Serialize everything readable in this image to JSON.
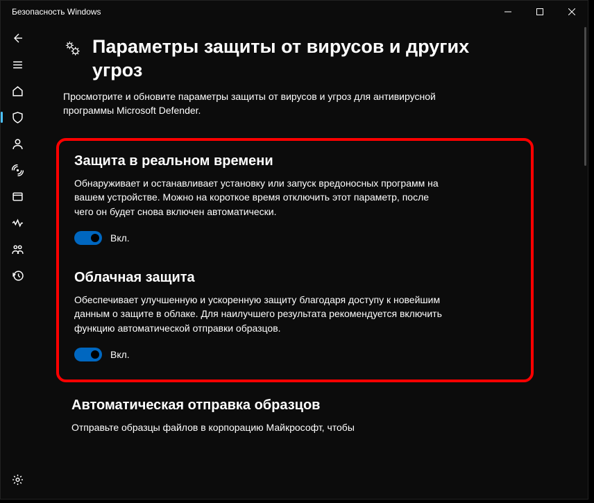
{
  "window": {
    "title": "Безопасность Windows"
  },
  "page": {
    "heading": "Параметры защиты от вирусов и других угроз",
    "subtitle": "Просмотрите и обновите параметры защиты от вирусов и угроз для антивирусной программы Microsoft Defender."
  },
  "sections": {
    "realtime": {
      "title": "Защита в реальном времени",
      "desc": "Обнаруживает и останавливает установку или запуск вредоносных программ на вашем устройстве. Можно на короткое время отключить этот параметр, после чего он будет снова включен автоматически.",
      "state_label": "Вкл.",
      "on": true
    },
    "cloud": {
      "title": "Облачная защита",
      "desc": "Обеспечивает улучшенную и ускоренную защиту благодаря доступу к новейшим данным о защите в облаке. Для наилучшего результата рекомендуется включить функцию автоматической отправки образцов.",
      "state_label": "Вкл.",
      "on": true
    },
    "sample": {
      "title": "Автоматическая отправка образцов",
      "desc": "Отправьте образцы файлов в корпорацию Майкрософт, чтобы"
    }
  }
}
